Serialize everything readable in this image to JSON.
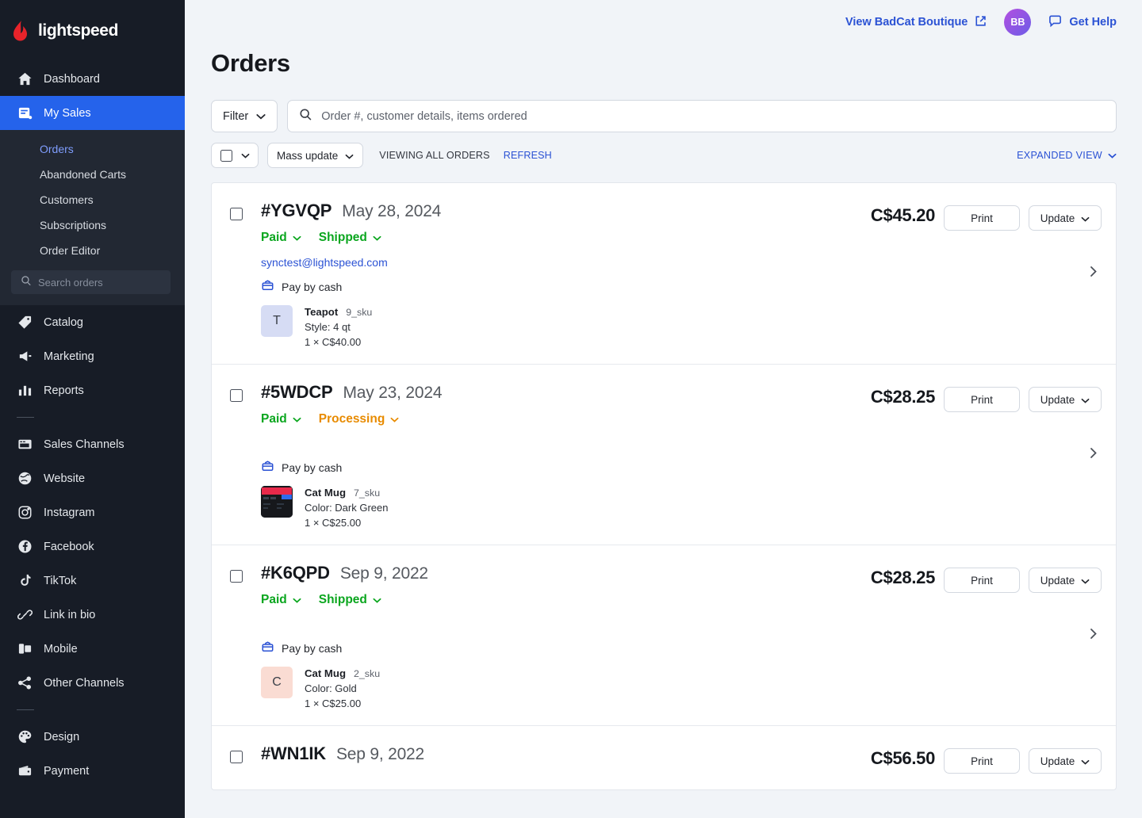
{
  "brand": {
    "name": "lightspeed",
    "accent": "#2563eb",
    "logo_color": "#e8232a"
  },
  "sidebar": {
    "search_placeholder": "Search orders",
    "primary": [
      {
        "label": "Dashboard",
        "icon": "home-icon"
      },
      {
        "label": "My Sales",
        "icon": "sales-icon",
        "active": true
      }
    ],
    "submenu": [
      {
        "label": "Orders",
        "current": true
      },
      {
        "label": "Abandoned Carts"
      },
      {
        "label": "Customers"
      },
      {
        "label": "Subscriptions"
      },
      {
        "label": "Order Editor"
      }
    ],
    "group2": [
      {
        "label": "Catalog",
        "icon": "tag-icon"
      },
      {
        "label": "Marketing",
        "icon": "megaphone-icon"
      },
      {
        "label": "Reports",
        "icon": "bar-chart-icon"
      }
    ],
    "group3": [
      {
        "label": "Sales Channels",
        "icon": "storefront-icon"
      },
      {
        "label": "Website",
        "icon": "globe-icon"
      },
      {
        "label": "Instagram",
        "icon": "instagram-icon"
      },
      {
        "label": "Facebook",
        "icon": "facebook-icon"
      },
      {
        "label": "TikTok",
        "icon": "tiktok-icon"
      },
      {
        "label": "Link in bio",
        "icon": "link-icon"
      },
      {
        "label": "Mobile",
        "icon": "mobile-icon"
      },
      {
        "label": "Other Channels",
        "icon": "share-nodes-icon"
      }
    ],
    "group4": [
      {
        "label": "Design",
        "icon": "palette-icon"
      },
      {
        "label": "Payment",
        "icon": "wallet-icon"
      }
    ]
  },
  "topbar": {
    "view_store_label": "View BadCat Boutique",
    "external_icon": "external-link-icon",
    "avatar_initials": "BB",
    "help_label": "Get Help",
    "help_icon": "chat-bubble-icon"
  },
  "page": {
    "title": "Orders"
  },
  "toolbar": {
    "filter_label": "Filter",
    "search_placeholder": "Order #, customer details, items ordered",
    "search_value": "",
    "mass_update_label": "Mass update",
    "viewing_label": "VIEWING ALL ORDERS",
    "refresh_label": "REFRESH",
    "expanded_view_label": "EXPANDED VIEW"
  },
  "buttons": {
    "print": "Print",
    "update": "Update"
  },
  "orders": [
    {
      "number": "#YGVQP",
      "date": "May 28, 2024",
      "total": "C$45.20",
      "payment_status": "Paid",
      "fulfillment_status": "Shipped",
      "fulfillment_kind": "shipped",
      "email": "synctest@lightspeed.com",
      "payment_method": "Pay by cash",
      "items": [
        {
          "name": "Teapot",
          "sku": "9_sku",
          "variant": "Style: 4 qt",
          "qty_price": "1 × C$40.00",
          "thumb_letter": "T",
          "thumb_bg": "#d6dcf4",
          "thumb_type": "letter"
        }
      ]
    },
    {
      "number": "#5WDCP",
      "date": "May 23, 2024",
      "total": "C$28.25",
      "payment_status": "Paid",
      "fulfillment_status": "Processing",
      "fulfillment_kind": "processing",
      "email": "",
      "payment_method": "Pay by cash",
      "items": [
        {
          "name": "Cat Mug",
          "sku": "7_sku",
          "variant": "Color: Dark Green",
          "qty_price": "1 × C$25.00",
          "thumb_letter": "",
          "thumb_bg": "#1d1f24",
          "thumb_type": "image"
        }
      ]
    },
    {
      "number": "#K6QPD",
      "date": "Sep 9, 2022",
      "total": "C$28.25",
      "payment_status": "Paid",
      "fulfillment_status": "Shipped",
      "fulfillment_kind": "shipped",
      "email": "",
      "payment_method": "Pay by cash",
      "items": [
        {
          "name": "Cat Mug",
          "sku": "2_sku",
          "variant": "Color: Gold",
          "qty_price": "1 × C$25.00",
          "thumb_letter": "C",
          "thumb_bg": "#fadcd3",
          "thumb_type": "letter"
        }
      ]
    },
    {
      "number": "#WN1IK",
      "date": "Sep 9, 2022",
      "total": "C$56.50",
      "payment_status": "",
      "fulfillment_status": "",
      "fulfillment_kind": "",
      "email": "",
      "payment_method": "",
      "items": []
    }
  ]
}
